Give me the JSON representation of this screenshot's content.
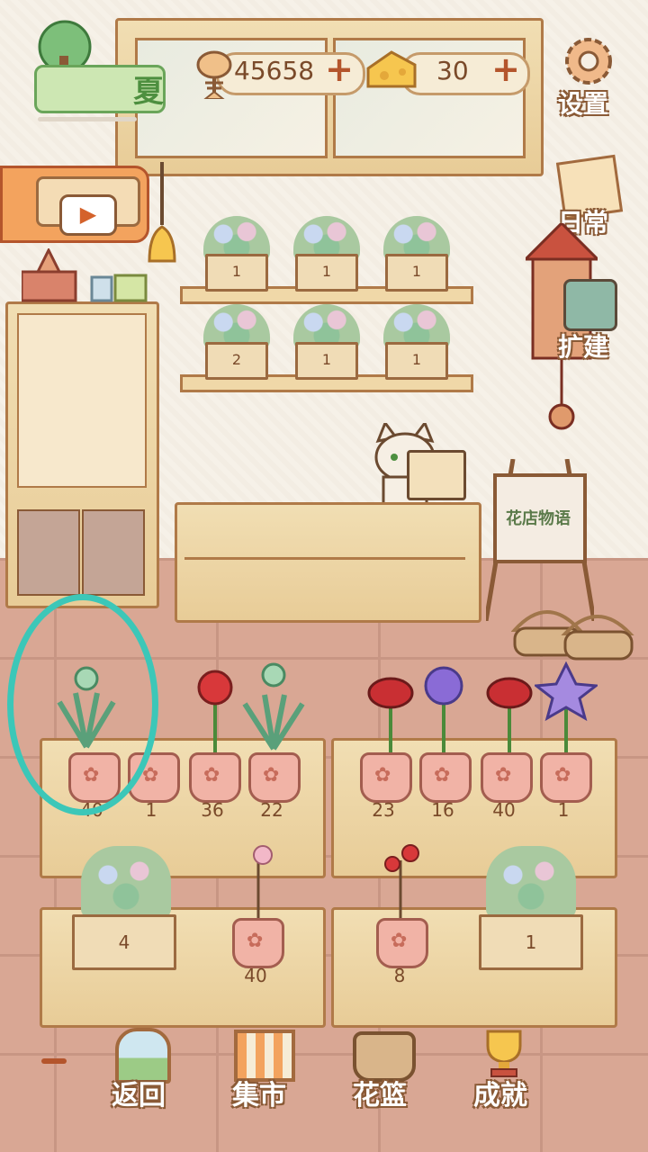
{
  "season": {
    "label": "夏",
    "icon": "tree-icon"
  },
  "currency": {
    "fish": {
      "icon": "fish-bone-icon",
      "value": "45658"
    },
    "cheese": {
      "icon": "cheese-icon",
      "value": "30"
    }
  },
  "side_buttons": {
    "settings": {
      "label": "设置",
      "icon": "gear-icon"
    },
    "daily": {
      "label": "日常",
      "icon": "memo-icon"
    },
    "expand": {
      "label": "扩建",
      "icon": "hammer-icon"
    }
  },
  "wall_shelf": {
    "counts": [
      "1",
      "1",
      "1",
      "2",
      "1",
      "1"
    ]
  },
  "easel_sign": "花店物语",
  "display_table_1": {
    "counts": [
      "40",
      "1",
      "36",
      "22"
    ]
  },
  "display_table_2": {
    "counts": [
      "23",
      "16",
      "40",
      "1"
    ]
  },
  "lower_table_1": {
    "bouquet_count": "4",
    "pot_count": "40"
  },
  "lower_table_2": {
    "pot_count": "8",
    "bouquet_count": "1"
  },
  "bottom_nav": [
    {
      "label": "返回",
      "icon": "window-icon"
    },
    {
      "label": "集市",
      "icon": "market-stall-icon"
    },
    {
      "label": "花篮",
      "icon": "flower-basket-icon"
    },
    {
      "label": "成就",
      "icon": "trophy-icon"
    }
  ],
  "colors": {
    "highlight_circle": "#3cc7b8",
    "plus_button": "#b4552c",
    "wall": "#f5efe6",
    "floor": "#d9a794"
  }
}
